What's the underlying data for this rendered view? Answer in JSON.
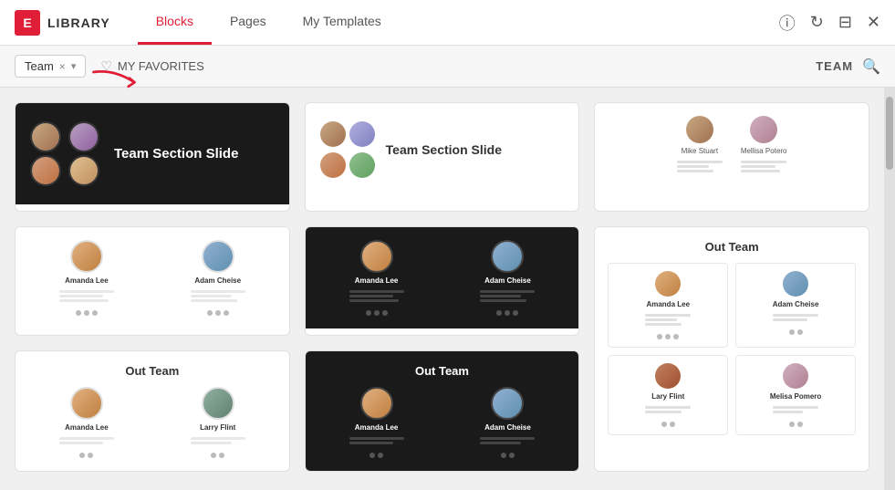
{
  "header": {
    "logo_letter": "E",
    "app_name": "LIBRARY",
    "tabs": [
      {
        "id": "blocks",
        "label": "Blocks",
        "active": true
      },
      {
        "id": "pages",
        "label": "Pages",
        "active": false
      },
      {
        "id": "my-templates",
        "label": "My Templates",
        "active": false
      }
    ],
    "icons": {
      "info": "ⓘ",
      "refresh": "↻",
      "save": "⊟",
      "close": "✕"
    }
  },
  "toolbar": {
    "filter_value": "Team",
    "filter_clear_label": "×",
    "filter_dropdown_label": "▾",
    "favorites_label": "MY FAVORITES",
    "search_label": "TEAM"
  },
  "cards": [
    {
      "id": "card1",
      "type": "dark-team-slide",
      "title": "Team Section Slide",
      "subtitle": ""
    },
    {
      "id": "card2",
      "type": "light-team-slide",
      "title": "Team Section Slide",
      "subtitle": ""
    },
    {
      "id": "card3",
      "type": "light-minimal-team",
      "persons": [
        {
          "name": "Mike Stuart"
        },
        {
          "name": "Mellisa Potero"
        }
      ]
    },
    {
      "id": "card4",
      "type": "light-members",
      "members": [
        {
          "name": "Amanda Lee"
        },
        {
          "name": "Adam Cheise"
        }
      ]
    },
    {
      "id": "card5",
      "type": "dark-members",
      "members": [
        {
          "name": "Amanda Lee"
        },
        {
          "name": "Adam Cheise"
        }
      ]
    },
    {
      "id": "card6",
      "type": "light-out-team-grid",
      "title": "Out Team",
      "members": [
        {
          "name": "Amanda Lee"
        },
        {
          "name": "Adam Cheise"
        },
        {
          "name": "Lary Flint"
        },
        {
          "name": "Melisa Pomero"
        }
      ]
    },
    {
      "id": "card7",
      "type": "light-out-team",
      "title": "Out Team",
      "members": [
        {
          "name": "Amanda Lee"
        },
        {
          "name": "Larry Flint"
        }
      ]
    },
    {
      "id": "card8",
      "type": "dark-out-team",
      "title": "Out Team",
      "members": [
        {
          "name": "Amanda Lee"
        },
        {
          "name": "Adam Cheise"
        }
      ]
    }
  ]
}
